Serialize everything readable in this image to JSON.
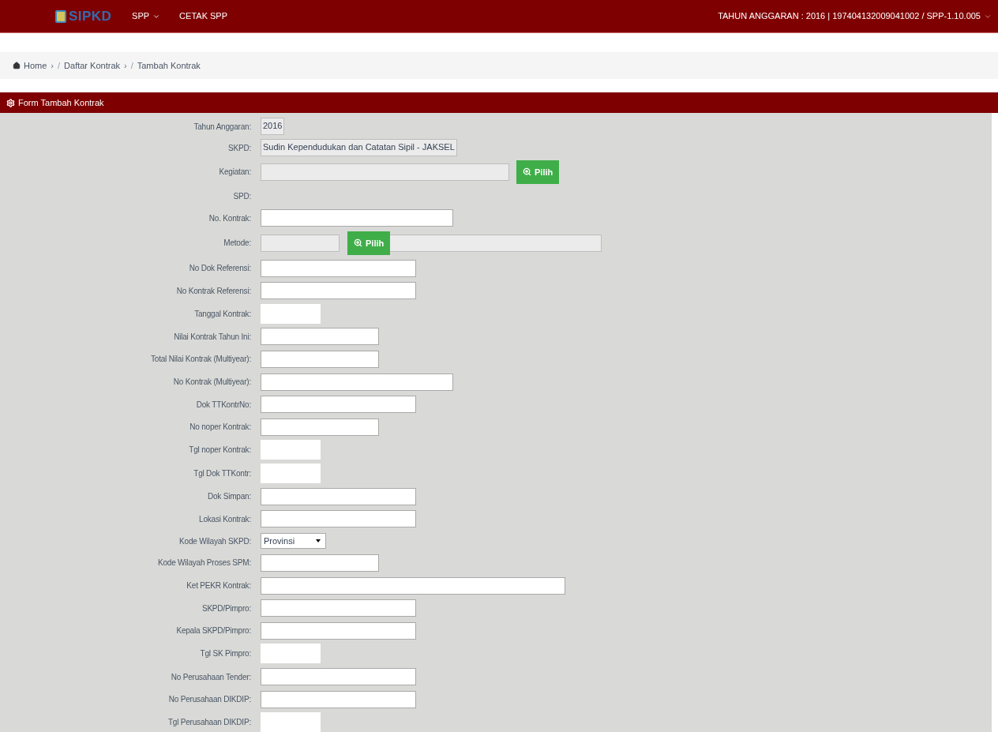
{
  "navbar": {
    "logo": "SIPKD",
    "menu": [
      {
        "label": "SPP",
        "dropdown": true
      },
      {
        "label": "CETAK SPP",
        "dropdown": false
      }
    ],
    "user_info": "TAHUN ANGGARAN : 2016 | 197404132009041002 / SPP-1.10.005"
  },
  "breadcrumb": [
    {
      "label": "Home",
      "home": true,
      "chevron": "›"
    },
    {
      "label": "Daftar Kontrak",
      "home": false,
      "slash": "/",
      "chevron": "›"
    },
    {
      "label": "Tambah Kontrak",
      "home": false,
      "slash": "/"
    }
  ],
  "panel": {
    "title": "Form Tambah Kontrak"
  },
  "fields": [
    {
      "label": "Tahun Anggaran:",
      "kind": "readonly",
      "value": "2016"
    },
    {
      "label": "SKPD:",
      "kind": "readonly",
      "value": "Sudin Kependudukan dan Catatan Sipil - JAKSEL"
    },
    {
      "label": "Kegiatan:",
      "kind": "picker",
      "button": "Pilih"
    },
    {
      "label": "SPD:",
      "kind": "none"
    },
    {
      "label": "No. Kontrak:",
      "kind": "long"
    },
    {
      "label": "Metode:",
      "kind": "method",
      "button": "Pilih"
    },
    {
      "label": "No Dok Referensi:",
      "kind": "medium"
    },
    {
      "label": "No Kontrak Referensi:",
      "kind": "medium"
    },
    {
      "label": "Tanggal Kontrak:",
      "kind": "date"
    },
    {
      "label": "Nilai Kontrak Tahun Ini:",
      "kind": "short"
    },
    {
      "label": "Total Nilai Kontrak (Multiyear):",
      "kind": "short"
    },
    {
      "label": "No Kontrak (Multiyear):",
      "kind": "long"
    },
    {
      "label": "Dok TTKontrNo:",
      "kind": "medium"
    },
    {
      "label": "No noper Kontrak:",
      "kind": "short"
    },
    {
      "label": "Tgl noper Kontrak:",
      "kind": "date"
    },
    {
      "label": "Tgl Dok TTKontr:",
      "kind": "date"
    },
    {
      "label": "Dok Simpan:",
      "kind": "medium"
    },
    {
      "label": "Lokasi Kontrak:",
      "kind": "medium"
    },
    {
      "label": "Kode Wilayah SKPD:",
      "kind": "select",
      "value": "Provinsi"
    },
    {
      "label": "Kode Wilayah Proses SPM:",
      "kind": "short"
    },
    {
      "label": "Ket PEKR Kontrak:",
      "kind": "wide"
    },
    {
      "label": "SKPD/Pimpro:",
      "kind": "medium"
    },
    {
      "label": "Kepala SKPD/Pimpro:",
      "kind": "medium"
    },
    {
      "label": "Tgl SK Pimpro:",
      "kind": "date"
    },
    {
      "label": "No Perusahaan Tender:",
      "kind": "medium"
    },
    {
      "label": "No Perusahaan DIKDIP:",
      "kind": "medium"
    },
    {
      "label": "Tgl Perusahaan DIKDIP:",
      "kind": "date"
    }
  ]
}
